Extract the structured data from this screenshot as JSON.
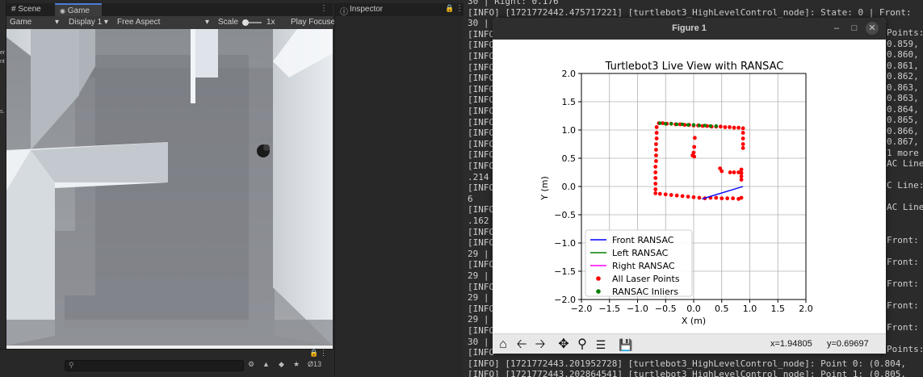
{
  "unity": {
    "tabs": [
      {
        "label": "Scene",
        "icon": "hash-icon"
      },
      {
        "label": "Game",
        "icon": "gamepad-icon"
      }
    ],
    "inspector_tab": "Inspector",
    "toolbar": {
      "mode": "Game",
      "display": "Display 1",
      "aspect": "Free Aspect",
      "scale_label": "Scale",
      "scale_value": "1x",
      "play_focused": "Play Focuse"
    },
    "left_strip_text": [
      "er",
      "nt",
      "s."
    ],
    "project_count": "13"
  },
  "terminal": {
    "lines": [
      "30 | Right: 0.176",
      "[INFO] [1721772442.475717221] [turtlebot3_HighLevelControl_node]: State: 0 | Front:",
      "30 |",
      "[INFO",
      "[INFO",
      "[INFO",
      "[INFO",
      "[INFO",
      "[INFO",
      "[INFO",
      "[INFO",
      "[INFO",
      "[INFO",
      "[INFO",
      "[INFO",
      "[INFO",
      ".214",
      "[INFO",
      "6",
      "[INFO",
      ".162",
      "[INFO",
      "[INFO",
      "29 |",
      "[INFO",
      "29 |",
      "[INFO",
      "29 |",
      "[INFO",
      "29 |",
      "[INFO",
      "30 |",
      "[INFO",
      "[INFO] [1721772443.201952728] [turtlebot3_HighLevelControl_node]: Point 0: (0.804,",
      "[INFO] [1721772443.202864541] [turtlebot3_HighLevelControl_node]: Point 1: (0.805,"
    ],
    "right_fragments": [
      "Points:",
      "0.859,",
      "0.860,",
      "0.861,",
      "0.862,",
      "0.863,",
      "0.863,",
      "0.864,",
      "0.865,",
      "0.866,",
      "0.867,",
      "1 more",
      "AC Line:",
      "",
      "C Line:",
      "",
      "AC Line",
      "",
      "",
      "Front:",
      "",
      "Front:",
      "",
      "Front:",
      "",
      "Front:",
      "",
      "Front:",
      "",
      "Points:"
    ]
  },
  "figure": {
    "window_title": "Figure 1",
    "toolbar_icons": [
      "home-icon",
      "back-icon",
      "forward-icon",
      "pan-icon",
      "zoom-icon",
      "configure-icon",
      "save-icon"
    ],
    "coords_x": "x=1.94805",
    "coords_y": "y=0.69697"
  },
  "chart_data": {
    "type": "scatter",
    "title": "Turtlebot3 Live View with RANSAC",
    "xlabel": "X (m)",
    "ylabel": "Y (m)",
    "xlim": [
      -2.0,
      2.0
    ],
    "ylim": [
      -2.0,
      2.0
    ],
    "xticks": [
      "−2.0",
      "−1.5",
      "−1.0",
      "−0.5",
      "0.0",
      "0.5",
      "1.0",
      "1.5",
      "2.0"
    ],
    "yticks": [
      "−2.0",
      "−1.5",
      "−1.0",
      "−0.5",
      "0.0",
      "0.5",
      "1.0",
      "1.5",
      "2.0"
    ],
    "grid": true,
    "legend_position": "lower-left",
    "legend": [
      {
        "name": "Front RANSAC",
        "marker": "line",
        "color": "#0000ff"
      },
      {
        "name": "Left RANSAC",
        "marker": "line",
        "color": "#008000"
      },
      {
        "name": "Right RANSAC",
        "marker": "line",
        "color": "#ff00ff"
      },
      {
        "name": "All Laser Points",
        "marker": "dot",
        "color": "#ff0000"
      },
      {
        "name": "RANSAC Inliers",
        "marker": "dot",
        "color": "#008000"
      }
    ],
    "series": [
      {
        "name": "All Laser Points",
        "color": "#ff0000",
        "points": [
          [
            -0.62,
            1.12
          ],
          [
            -0.55,
            1.12
          ],
          [
            -0.48,
            1.11
          ],
          [
            -0.4,
            1.11
          ],
          [
            -0.32,
            1.1
          ],
          [
            -0.24,
            1.1
          ],
          [
            -0.16,
            1.09
          ],
          [
            -0.08,
            1.09
          ],
          [
            0.0,
            1.08
          ],
          [
            0.08,
            1.08
          ],
          [
            0.16,
            1.07
          ],
          [
            0.24,
            1.07
          ],
          [
            0.32,
            1.06
          ],
          [
            0.4,
            1.06
          ],
          [
            0.48,
            1.06
          ],
          [
            0.56,
            1.05
          ],
          [
            0.64,
            1.05
          ],
          [
            0.72,
            1.04
          ],
          [
            0.8,
            1.04
          ],
          [
            0.88,
            1.03
          ],
          [
            -0.66,
            1.05
          ],
          [
            -0.66,
            0.95
          ],
          [
            -0.66,
            0.85
          ],
          [
            -0.67,
            0.75
          ],
          [
            -0.67,
            0.65
          ],
          [
            -0.67,
            0.55
          ],
          [
            -0.67,
            0.45
          ],
          [
            -0.68,
            0.35
          ],
          [
            -0.68,
            0.25
          ],
          [
            -0.68,
            0.15
          ],
          [
            -0.68,
            0.05
          ],
          [
            -0.68,
            -0.05
          ],
          [
            -0.68,
            -0.12
          ],
          [
            -0.6,
            -0.13
          ],
          [
            -0.5,
            -0.14
          ],
          [
            -0.4,
            -0.15
          ],
          [
            -0.3,
            -0.16
          ],
          [
            -0.2,
            -0.17
          ],
          [
            -0.1,
            -0.18
          ],
          [
            0.0,
            -0.19
          ],
          [
            0.1,
            -0.2
          ],
          [
            0.2,
            -0.21
          ],
          [
            0.3,
            -0.2
          ],
          [
            0.4,
            -0.2
          ],
          [
            0.5,
            -0.21
          ],
          [
            0.6,
            -0.21
          ],
          [
            0.7,
            -0.21
          ],
          [
            0.8,
            -0.22
          ],
          [
            0.85,
            -0.2
          ],
          [
            0.88,
            0.95
          ],
          [
            0.88,
            0.85
          ],
          [
            0.88,
            0.75
          ],
          [
            0.88,
            0.68
          ],
          [
            0.85,
            0.3
          ],
          [
            0.85,
            0.24
          ],
          [
            0.85,
            0.18
          ],
          [
            0.85,
            0.12
          ],
          [
            0.8,
            0.25
          ],
          [
            0.72,
            0.25
          ],
          [
            0.65,
            0.25
          ],
          [
            0.5,
            0.27
          ],
          [
            0.47,
            0.32
          ],
          [
            0.02,
            0.86
          ],
          [
            0.01,
            0.7
          ],
          [
            0.0,
            0.6
          ],
          [
            -0.02,
            0.55
          ],
          [
            0.01,
            0.53
          ]
        ]
      },
      {
        "name": "RANSAC Inliers",
        "color": "#008000",
        "points": [
          [
            -0.6,
            1.12
          ],
          [
            -0.5,
            1.11
          ],
          [
            -0.4,
            1.11
          ],
          [
            -0.3,
            1.1
          ],
          [
            -0.2,
            1.1
          ],
          [
            -0.1,
            1.09
          ],
          [
            0.0,
            1.09
          ],
          [
            0.1,
            1.08
          ],
          [
            0.2,
            1.08
          ],
          [
            0.3,
            1.07
          ],
          [
            0.4,
            1.07
          ]
        ]
      },
      {
        "name": "Front RANSAC",
        "color": "#0000ff",
        "line": [
          [
            0.15,
            -0.22
          ],
          [
            0.88,
            0.0
          ]
        ]
      }
    ]
  }
}
